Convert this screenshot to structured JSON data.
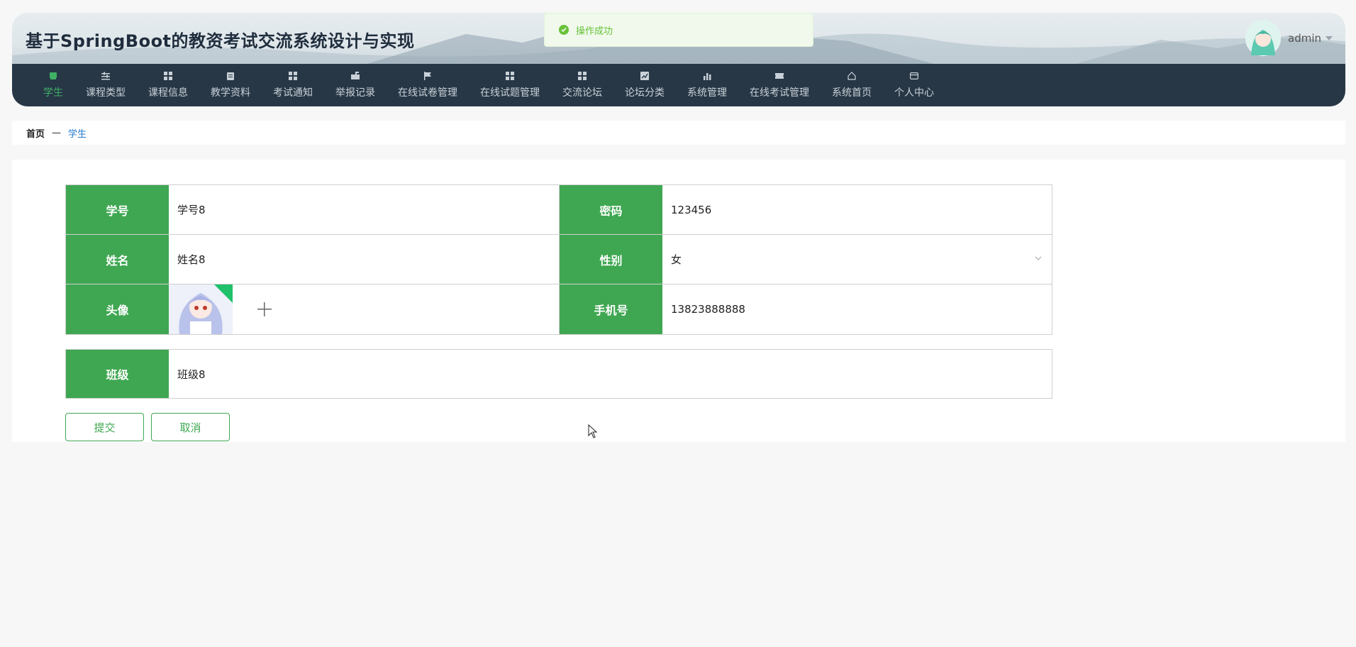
{
  "header": {
    "title": "基于SpringBoot的教资考试交流系统设计与实现",
    "username": "admin"
  },
  "nav": {
    "items": [
      {
        "label": "学生",
        "icon": "book-icon",
        "active": true
      },
      {
        "label": "课程类型",
        "icon": "sliders-icon"
      },
      {
        "label": "课程信息",
        "icon": "grid-icon"
      },
      {
        "label": "教学资料",
        "icon": "clipboard-icon"
      },
      {
        "label": "考试通知",
        "icon": "grid-icon"
      },
      {
        "label": "举报记录",
        "icon": "mail-icon"
      },
      {
        "label": "在线试卷管理",
        "icon": "flag-icon"
      },
      {
        "label": "在线试题管理",
        "icon": "grid-icon"
      },
      {
        "label": "交流论坛",
        "icon": "grid-icon"
      },
      {
        "label": "论坛分类",
        "icon": "chart-icon"
      },
      {
        "label": "系统管理",
        "icon": "bar-chart-icon"
      },
      {
        "label": "在线考试管理",
        "icon": "ticket-icon"
      },
      {
        "label": "系统首页",
        "icon": "home-icon"
      },
      {
        "label": "个人中心",
        "icon": "card-icon"
      }
    ]
  },
  "breadcrumb": {
    "home": "首页",
    "separator": "—",
    "current": "学生"
  },
  "form": {
    "student_no_label": "学号",
    "student_no_value": "学号8",
    "password_label": "密码",
    "password_value": "123456",
    "name_label": "姓名",
    "name_value": "姓名8",
    "gender_label": "性别",
    "gender_value": "女",
    "avatar_label": "头像",
    "phone_label": "手机号",
    "phone_value": "13823888888",
    "class_label": "班级",
    "class_value": "班级8"
  },
  "actions": {
    "submit": "提交",
    "cancel": "取消"
  },
  "toast": {
    "message": "操作成功"
  },
  "colors": {
    "accent": "#3fa751",
    "nav_bg": "#273746",
    "nav_active": "#3fb064",
    "toast_text": "#67c23a"
  }
}
